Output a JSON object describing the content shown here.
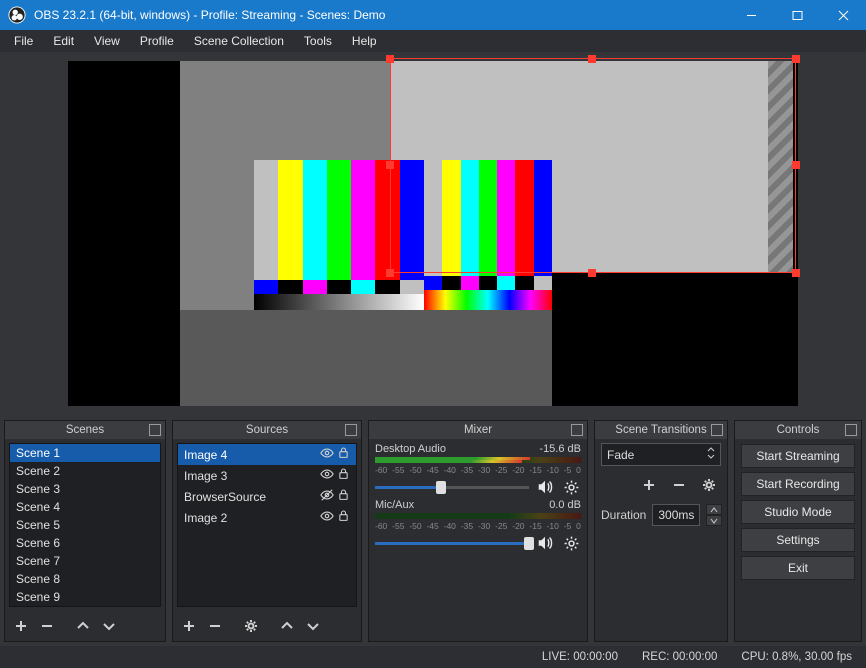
{
  "window": {
    "title": "OBS 23.2.1 (64-bit, windows) - Profile: Streaming - Scenes: Demo"
  },
  "menubar": [
    "File",
    "Edit",
    "View",
    "Profile",
    "Scene Collection",
    "Tools",
    "Help"
  ],
  "docks": {
    "scenes": {
      "title": "Scenes",
      "items": [
        "Scene 1",
        "Scene 2",
        "Scene 3",
        "Scene 4",
        "Scene 5",
        "Scene 6",
        "Scene 7",
        "Scene 8",
        "Scene 9"
      ],
      "selected_index": 0
    },
    "sources": {
      "title": "Sources",
      "items": [
        {
          "name": "Image 4",
          "visible": true,
          "locked": true
        },
        {
          "name": "Image 3",
          "visible": true,
          "locked": true
        },
        {
          "name": "BrowserSource",
          "visible": false,
          "locked": true
        },
        {
          "name": "Image 2",
          "visible": true,
          "locked": true
        }
      ],
      "selected_index": 0
    },
    "mixer": {
      "title": "Mixer",
      "ticks": [
        "-60",
        "-55",
        "-50",
        "-45",
        "-40",
        "-35",
        "-30",
        "-25",
        "-20",
        "-15",
        "-10",
        "-5",
        "0"
      ],
      "channels": [
        {
          "name": "Desktop Audio",
          "db": "-15.6 dB",
          "slider": 0.43,
          "level": 0.75
        },
        {
          "name": "Mic/Aux",
          "db": "0.0 dB",
          "slider": 1.0,
          "level": 0.0
        }
      ]
    },
    "transitions": {
      "title": "Scene Transitions",
      "selected": "Fade",
      "duration_label": "Duration",
      "duration_value": "300ms"
    },
    "controls": {
      "title": "Controls",
      "buttons": [
        "Start Streaming",
        "Start Recording",
        "Studio Mode",
        "Settings",
        "Exit"
      ]
    }
  },
  "statusbar": {
    "live": "LIVE: 00:00:00",
    "rec": "REC: 00:00:00",
    "cpu": "CPU: 0.8%, 30.00 fps"
  }
}
